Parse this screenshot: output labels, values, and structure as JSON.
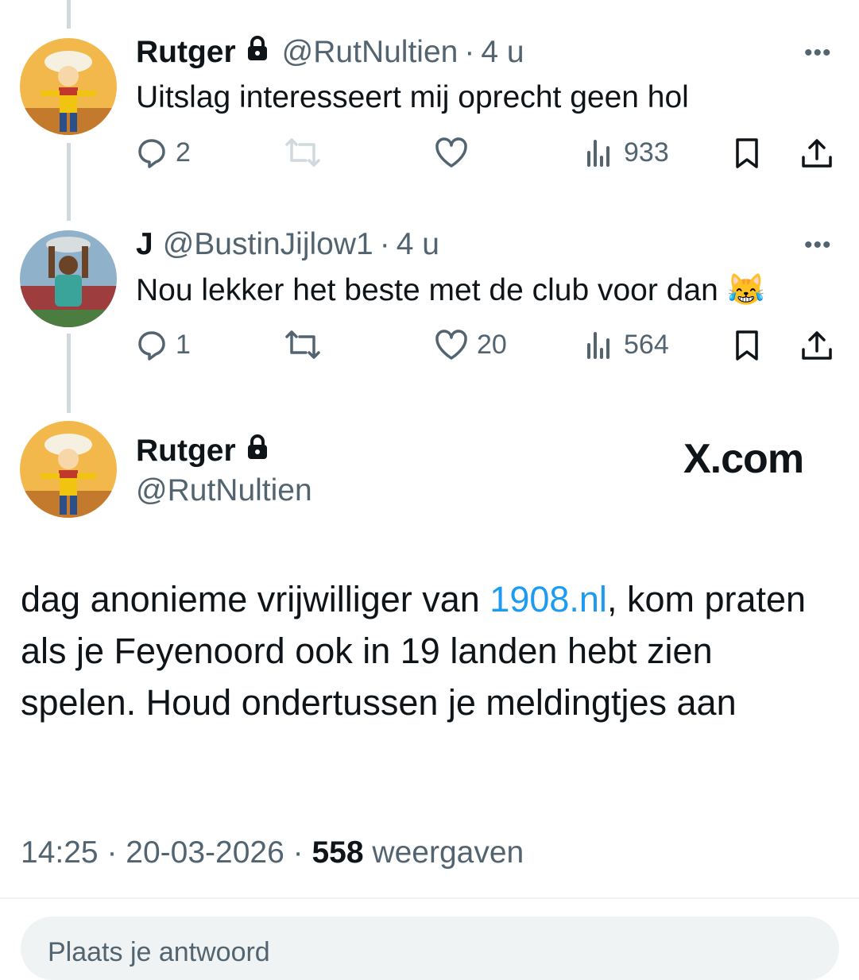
{
  "tweets": [
    {
      "name": "Rutger",
      "handle": "@RutNultien",
      "time": "4 u",
      "text": "Uitslag interesseert mij oprecht geen hol",
      "replies": "2",
      "retweets": "",
      "likes": "",
      "views": "933"
    },
    {
      "name": "J",
      "handle": "@BustinJijlow1",
      "time": "4 u",
      "text": "Nou lekker het beste met de club voor dan 😹",
      "replies": "1",
      "retweets": "",
      "likes": "20",
      "views": "564"
    }
  ],
  "main": {
    "name": "Rutger",
    "handle": "@RutNultien",
    "brand": "X.com",
    "text_before": "dag anonieme vrijwilliger van ",
    "link": "1908.nl",
    "text_after": ", kom praten als je Feyenoord ook in 19 landen hebt zien spelen. Houd ondertussen je meldingtjes aan",
    "time": "14:25",
    "date": "20-03-2026",
    "views_count": "558",
    "views_label": "weergaven"
  },
  "reply": {
    "placeholder": "Plaats je antwoord"
  },
  "separator": "·",
  "more_label": "•••",
  "icons": [
    "lock-icon",
    "reply-icon",
    "retweet-icon",
    "like-icon",
    "views-icon",
    "bookmark-icon",
    "share-icon",
    "more-icon"
  ],
  "colors": {
    "link": "#1d9bf0",
    "muted": "#536471",
    "thread_line": "#cfd9de",
    "text": "#0f1419"
  }
}
